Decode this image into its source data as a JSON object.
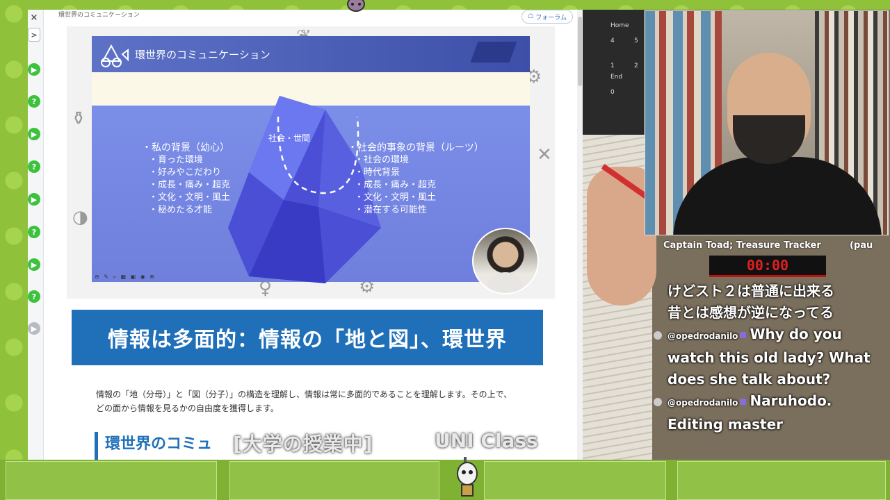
{
  "page": {
    "header_title": "環世界のコミュニケーション",
    "forum_label": "フォーラム"
  },
  "sidebar": {
    "close_symbol": "×",
    "next_symbol": ">",
    "items": [
      {
        "kind": "play",
        "symbol": "▶"
      },
      {
        "kind": "quiz",
        "symbol": "?"
      },
      {
        "kind": "play",
        "symbol": "▶"
      },
      {
        "kind": "quiz",
        "symbol": "?"
      },
      {
        "kind": "play",
        "symbol": "▶"
      },
      {
        "kind": "quiz",
        "symbol": "?"
      },
      {
        "kind": "play",
        "symbol": "▶"
      },
      {
        "kind": "quiz",
        "symbol": "?"
      },
      {
        "kind": "current",
        "symbol": "▶"
      }
    ]
  },
  "slide": {
    "title": "環世界のコミュニケーション",
    "center_label": "社会・世間",
    "left_heading": "・私の背景（幼心）",
    "left_items": [
      "・育った環境",
      "・好みやこだわり",
      "・成長・痛み・超克",
      "・文化・文明・風土",
      "・秘めたる才能"
    ],
    "right_heading": "・社会的事象の背景（ルーツ）",
    "right_items": [
      "・社会の環境",
      "・時代背景",
      "・成長・痛み・超克",
      "・文化・文明・風土",
      "・潜在する可能性"
    ]
  },
  "article": {
    "banner": "情報は多面的：情報の「地と図」、環世界",
    "body": "情報の「地（分母）」と「図（分子）」の構造を理解し、情報は常に多面的であることを理解します。その上で、どの面から情報を見るかの自由度を獲得します。",
    "subhead": "環世界のコミュ"
  },
  "overlay": {
    "caption": "[大学の授業中]",
    "class_label": "UNI Class"
  },
  "keyboard": {
    "keys": [
      "Home",
      "4",
      "5",
      "1",
      "2",
      "End",
      "0"
    ]
  },
  "stream": {
    "game_title": "Captain Toad; Treasure Tracker",
    "game_extra": "(pau",
    "timer": "00:00"
  },
  "chat": {
    "lines": [
      {
        "type": "text",
        "text": "けどスト２は普通に出来る"
      },
      {
        "type": "text",
        "text": "昔とは感想が逆になってる"
      },
      {
        "type": "message",
        "user": "@opedrodanilo",
        "text": "Why do you watch this old lady? What does she talk about?"
      },
      {
        "type": "message",
        "user": "@opedrodanilo",
        "text": "Naruhodo. Editing master"
      }
    ]
  },
  "colors": {
    "banner_blue": "#1f70b8",
    "frame_green": "#8fc23a",
    "timer_red": "#e02020",
    "sidebar_green": "#3cc23c"
  }
}
